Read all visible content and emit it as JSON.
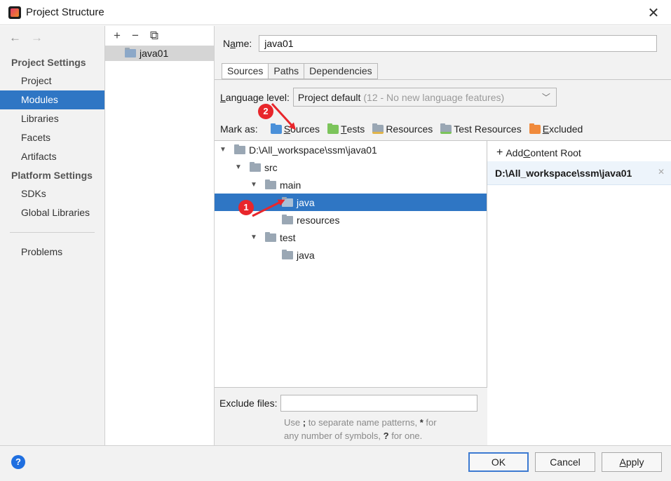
{
  "window": {
    "title": "Project Structure",
    "close_glyph": "✕"
  },
  "nav": {
    "back": "←",
    "forward": "→",
    "project_settings_header": "Project Settings",
    "project_items": [
      "Project",
      "Modules",
      "Libraries",
      "Facets",
      "Artifacts"
    ],
    "selected": "Modules",
    "platform_settings_header": "Platform Settings",
    "platform_items": [
      "SDKs",
      "Global Libraries"
    ],
    "problems": "Problems"
  },
  "modules": {
    "toolbar": {
      "add": "+",
      "remove": "−",
      "copy": "⧉"
    },
    "items": [
      "java01"
    ]
  },
  "details": {
    "name_label_pre": "N",
    "name_label_u": "a",
    "name_label_post": "me:",
    "name_value": "java01",
    "tabs": [
      "Sources",
      "Paths",
      "Dependencies"
    ],
    "active_tab": "Sources",
    "language_level_label_pre": "",
    "language_level_label_u": "L",
    "language_level_label_post": "anguage level:",
    "language_level_value": "Project default",
    "language_level_hint": "(12 - No new language features)",
    "mark_as_label": "Mark as:",
    "mark_as": [
      {
        "u": "S",
        "rest": "ources",
        "color": "#4a90d9"
      },
      {
        "u": "T",
        "rest": "ests",
        "color": "#7cc45b"
      },
      {
        "u": "",
        "rest": "Resources",
        "color": "#9aa7b4"
      },
      {
        "u": "",
        "rest": "Test Resources",
        "color": "#9aa7b4"
      },
      {
        "u": "E",
        "rest": "xcluded",
        "color": "#f08a3c"
      }
    ],
    "tree": [
      {
        "label": "D:\\All_workspace\\ssm\\java01",
        "depth": 0,
        "expanded": true
      },
      {
        "label": "src",
        "depth": 1,
        "expanded": true
      },
      {
        "label": "main",
        "depth": 2,
        "expanded": true
      },
      {
        "label": "java",
        "depth": 3,
        "selected": true
      },
      {
        "label": "resources",
        "depth": 3
      },
      {
        "label": "test",
        "depth": 2,
        "expanded": true
      },
      {
        "label": "java",
        "depth": 3
      }
    ],
    "exclude_files_label": "Exclude files:",
    "exclude_files_value": "",
    "exclude_hint_line1_a": "Use ",
    "exclude_hint_line1_b": ";",
    "exclude_hint_line1_c": " to separate name patterns, ",
    "exclude_hint_line1_d": "*",
    "exclude_hint_line1_e": " for",
    "exclude_hint_line2_a": "any number of symbols, ",
    "exclude_hint_line2_b": "?",
    "exclude_hint_line2_c": " for one.",
    "add_content_root_pre": "Add ",
    "add_content_root_u": "C",
    "add_content_root_post": "ontent Root",
    "content_root": "D:\\All_workspace\\ssm\\java01"
  },
  "annotations": {
    "badge1": "1",
    "badge2": "2",
    "color": "#e8262b"
  },
  "footer": {
    "help": "?",
    "ok": "OK",
    "cancel": "Cancel",
    "apply_u": "A",
    "apply_rest": "pply"
  }
}
